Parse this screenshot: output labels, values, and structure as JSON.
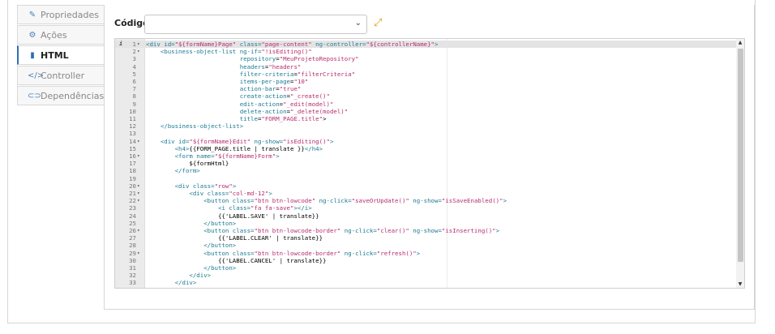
{
  "tabs": [
    {
      "label": "Propriedades",
      "icon": "edit-icon",
      "glyph": "✎"
    },
    {
      "label": "Ações",
      "icon": "cogs-icon",
      "glyph": "⚙"
    },
    {
      "label": "HTML",
      "icon": "file-icon",
      "glyph": "▮"
    },
    {
      "label": "Controller",
      "icon": "code-icon",
      "glyph": "</>"
    },
    {
      "label": "Dependências",
      "icon": "link-icon",
      "glyph": "⊂⊃"
    }
  ],
  "active_tab": "HTML",
  "codigo": {
    "label": "Código",
    "selected": ""
  },
  "colors": {
    "accent": "#2d6fb4",
    "expand": "#e2a013",
    "tag": "#1d7a93",
    "string": "#b52d6f"
  },
  "editor": {
    "lines": [
      {
        "n": "1",
        "fold": true,
        "code": "<div id=\"${formName}Page\" class=\"page-content\" ng-controller=\"${controllerName}\">"
      },
      {
        "n": "2",
        "fold": true,
        "code": "    <business-object-list ng-if=\"!isEditing()\""
      },
      {
        "n": "3",
        "fold": false,
        "code": "                          repository=\"MeuProjetoRepository\""
      },
      {
        "n": "4",
        "fold": false,
        "code": "                          headers=\"headers\""
      },
      {
        "n": "5",
        "fold": false,
        "code": "                          filter-criteria=\"filterCriteria\""
      },
      {
        "n": "6",
        "fold": false,
        "code": "                          items-per-page=\"10\""
      },
      {
        "n": "7",
        "fold": false,
        "code": "                          action-bar=\"true\""
      },
      {
        "n": "8",
        "fold": false,
        "code": "                          create-action=\"_create()\""
      },
      {
        "n": "9",
        "fold": false,
        "code": "                          edit-action=\"_edit(model)\""
      },
      {
        "n": "10",
        "fold": false,
        "code": "                          delete-action=\"_delete(model)\""
      },
      {
        "n": "11",
        "fold": false,
        "code": "                          title=\"FORM_PAGE.title\">"
      },
      {
        "n": "12",
        "fold": false,
        "code": "    </business-object-list>"
      },
      {
        "n": "13",
        "fold": false,
        "code": ""
      },
      {
        "n": "14",
        "fold": true,
        "code": "    <div id=\"${formName}Edit\" ng-show=\"isEditing()\">"
      },
      {
        "n": "15",
        "fold": false,
        "code": "        <h4>{{FORM_PAGE.title | translate }}</h4>"
      },
      {
        "n": "16",
        "fold": true,
        "code": "        <form name=\"${formName}Form\">"
      },
      {
        "n": "17",
        "fold": false,
        "code": "            ${formHtml}"
      },
      {
        "n": "18",
        "fold": false,
        "code": "        </form>"
      },
      {
        "n": "19",
        "fold": false,
        "code": ""
      },
      {
        "n": "20",
        "fold": true,
        "code": "        <div class=\"row\">"
      },
      {
        "n": "21",
        "fold": true,
        "code": "            <div class=\"col-md-12\">"
      },
      {
        "n": "22",
        "fold": true,
        "code": "                <button class=\"btn btn-lowcode\" ng-click=\"saveOrUpdate()\" ng-show=\"isSaveEnabled()\">"
      },
      {
        "n": "23",
        "fold": false,
        "code": "                    <i class=\"fa fa-save\"></i>"
      },
      {
        "n": "24",
        "fold": false,
        "code": "                    {{'LABEL.SAVE' | translate}}"
      },
      {
        "n": "25",
        "fold": false,
        "code": "                </button>"
      },
      {
        "n": "26",
        "fold": true,
        "code": "                <button class=\"btn btn-lowcode-border\" ng-click=\"clear()\" ng-show=\"isInserting()\">"
      },
      {
        "n": "27",
        "fold": false,
        "code": "                    {{'LABEL.CLEAR' | translate}}"
      },
      {
        "n": "28",
        "fold": false,
        "code": "                </button>"
      },
      {
        "n": "29",
        "fold": true,
        "code": "                <button class=\"btn btn-lowcode-border\" ng-click=\"refresh()\">"
      },
      {
        "n": "30",
        "fold": false,
        "code": "                    {{'LABEL.CANCEL' | translate}}"
      },
      {
        "n": "31",
        "fold": false,
        "code": "                </button>"
      },
      {
        "n": "32",
        "fold": false,
        "code": "            </div>"
      },
      {
        "n": "33",
        "fold": false,
        "code": "        </div>"
      }
    ]
  }
}
